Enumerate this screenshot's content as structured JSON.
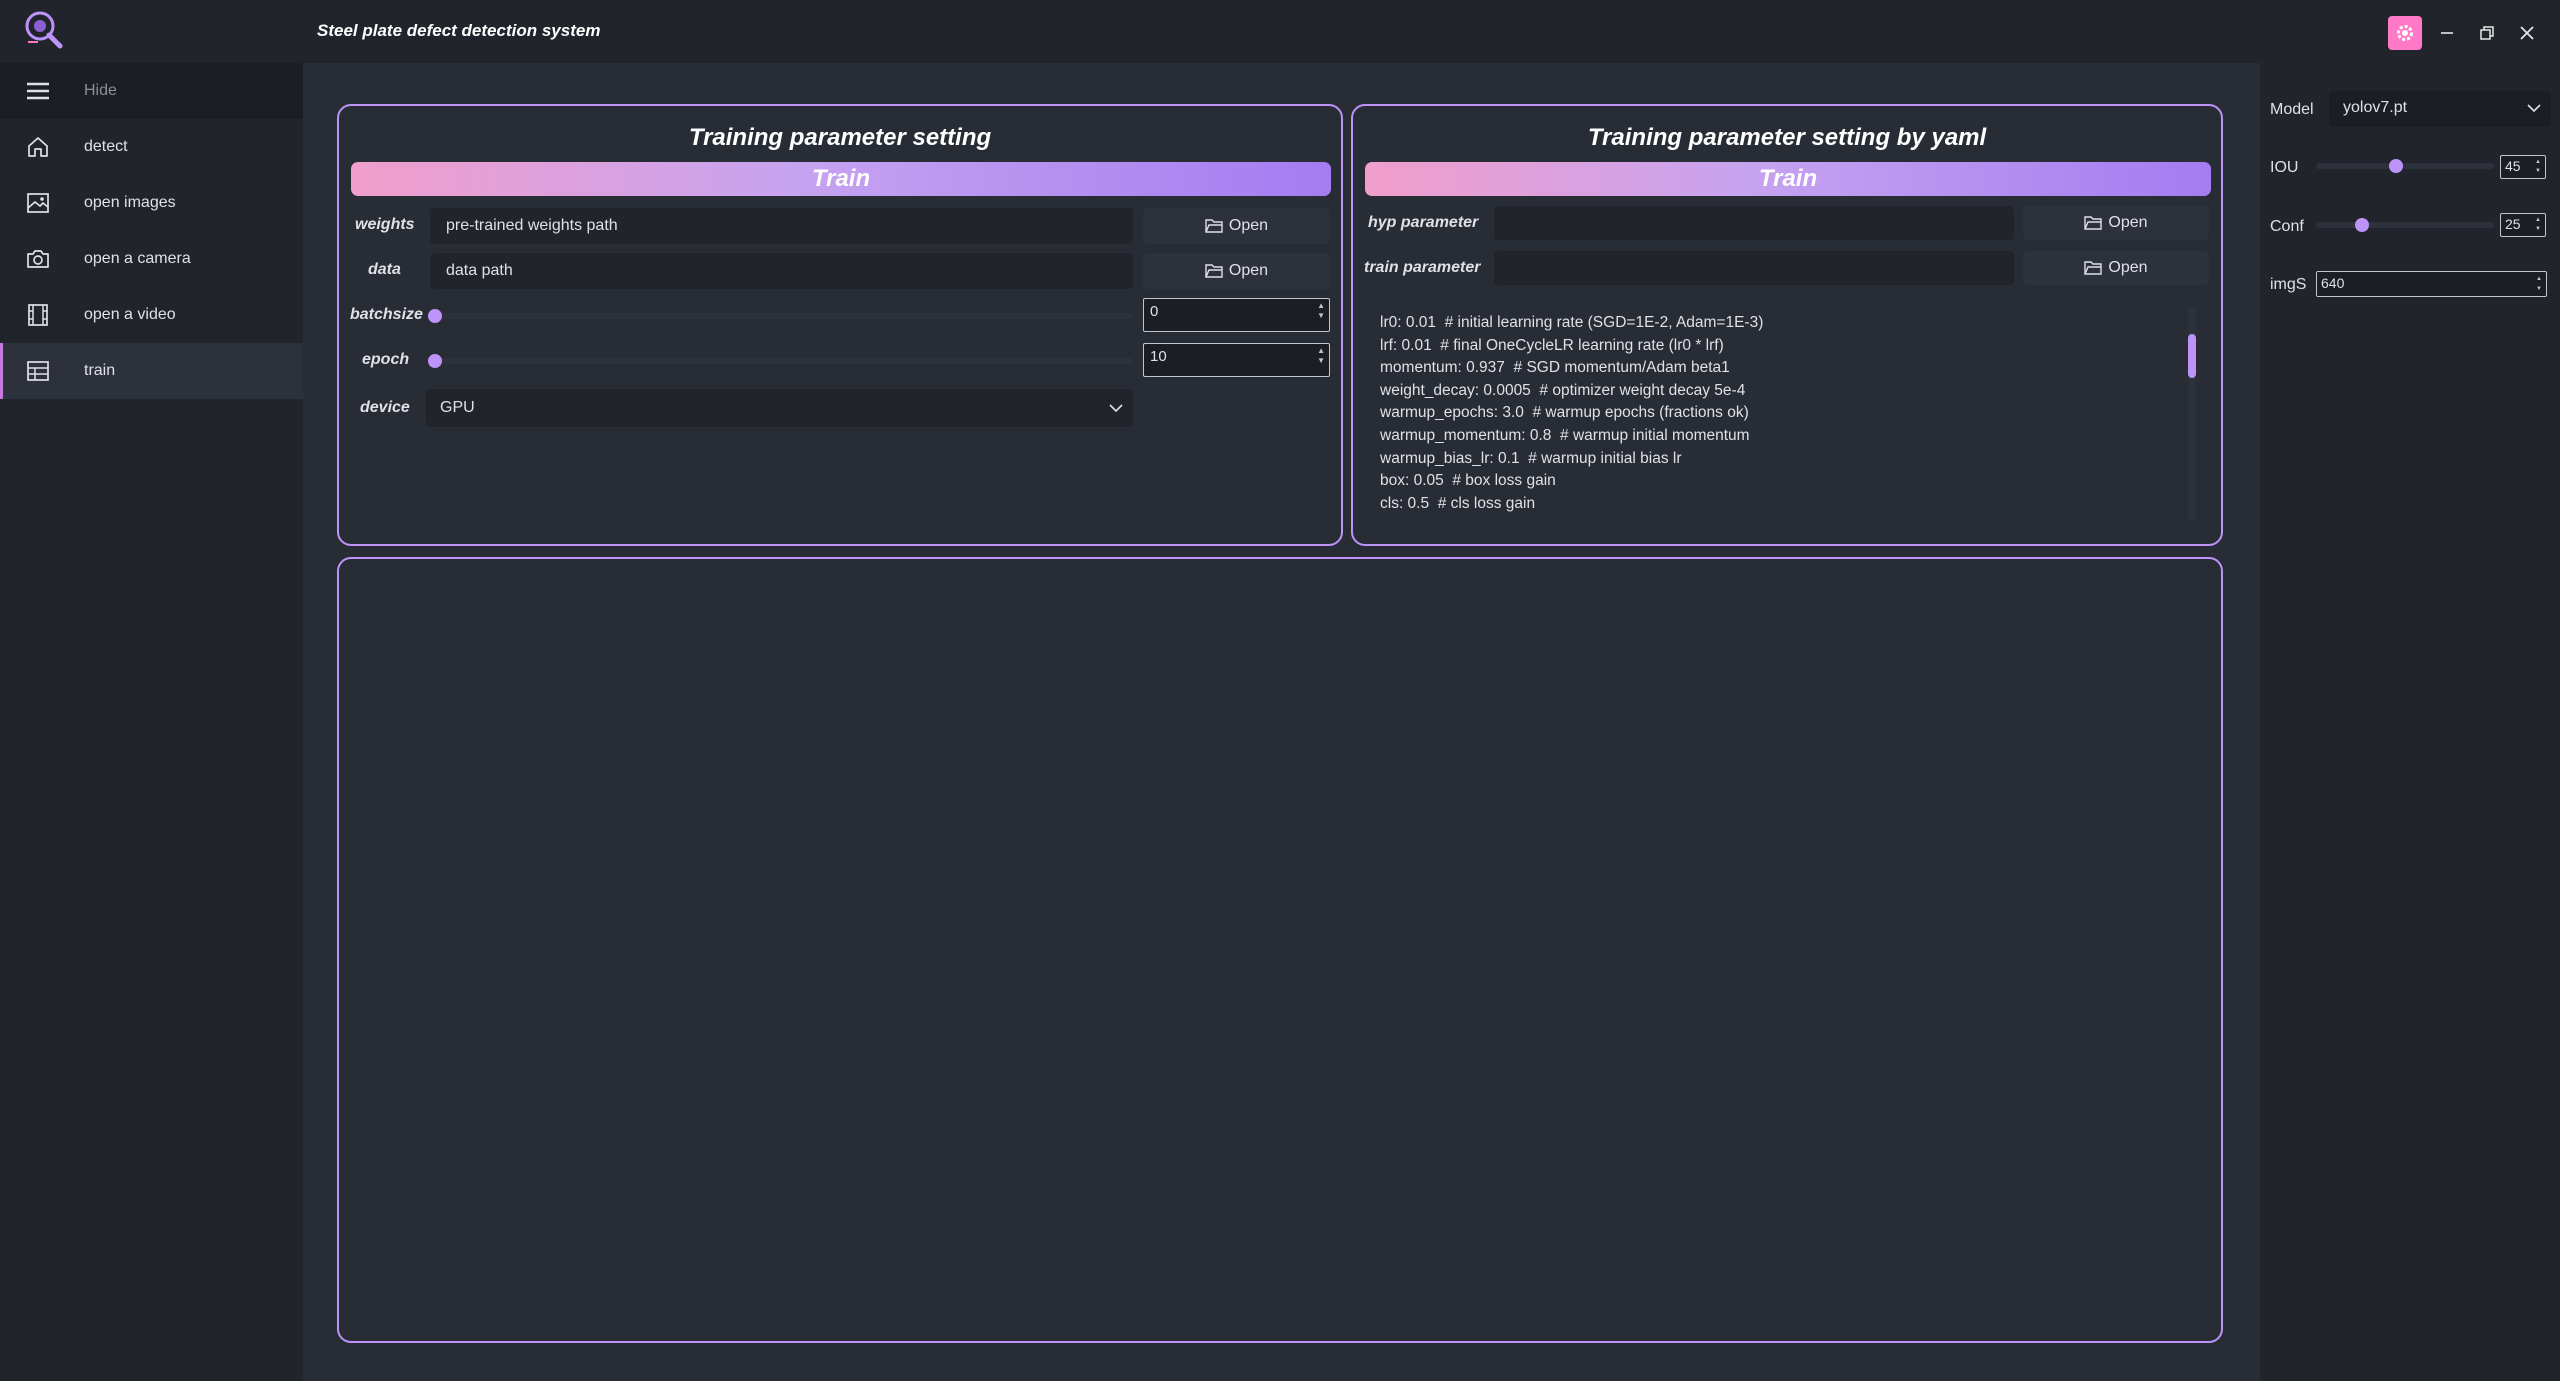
{
  "window": {
    "title": "Steel plate defect detection system",
    "settings_icon": "gear-icon",
    "accent": "#ff79c6"
  },
  "sidebar": {
    "hide_label": "Hide",
    "items": [
      {
        "label": "detect",
        "icon": "home-icon"
      },
      {
        "label": "open images",
        "icon": "image-icon"
      },
      {
        "label": "open a camera",
        "icon": "camera-icon"
      },
      {
        "label": "open a video",
        "icon": "film-icon"
      },
      {
        "label": "train",
        "icon": "table-icon"
      }
    ]
  },
  "left_panel": {
    "title": "Training parameter setting",
    "train_label": "Train",
    "weights": {
      "label": "weights",
      "placeholder": "pre-trained weights path",
      "open_label": "Open"
    },
    "data": {
      "label": "data",
      "placeholder": "data path",
      "open_label": "Open"
    },
    "batchsize": {
      "label": "batchsize",
      "value": "0"
    },
    "epoch": {
      "label": "epoch",
      "value": "10"
    },
    "device": {
      "label": "device",
      "value": "GPU"
    }
  },
  "right_panel": {
    "title": "Training parameter setting by yaml",
    "train_label": "Train",
    "hyp": {
      "label": "hyp parameter",
      "open_label": "Open"
    },
    "train_param": {
      "label": "train parameter",
      "open_label": "Open"
    },
    "yaml_lines": [
      "lr0: 0.01  # initial learning rate (SGD=1E-2, Adam=1E-3)",
      "lrf: 0.01  # final OneCycleLR learning rate (lr0 * lrf)",
      "momentum: 0.937  # SGD momentum/Adam beta1",
      "weight_decay: 0.0005  # optimizer weight decay 5e-4",
      "warmup_epochs: 3.0  # warmup epochs (fractions ok)",
      "warmup_momentum: 0.8  # warmup initial momentum",
      "warmup_bias_lr: 0.1  # warmup initial bias lr",
      "box: 0.05  # box loss gain",
      "cls: 0.5  # cls loss gain"
    ]
  },
  "settings_panel": {
    "model_label": "Model",
    "model_value": "yolov7.pt",
    "iou_label": "IOU",
    "iou_value": "45",
    "conf_label": "Conf",
    "conf_value": "25",
    "imgs_label": "imgS",
    "imgs_value": "640"
  }
}
